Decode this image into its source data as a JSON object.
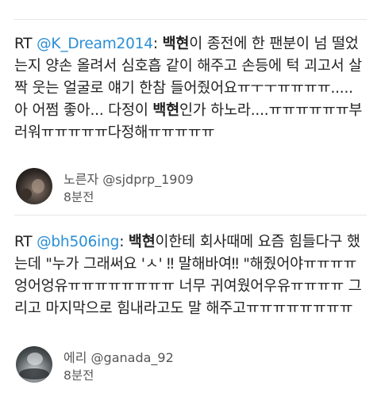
{
  "tweets": [
    {
      "prefix": "RT ",
      "mention": "@K_Dream2014",
      "colon": ": ",
      "bold1": "백현",
      "text1": "이 종전에 한 팬분이 넘 떨었는지 양손 올려서 심호흡 같이 해주고 손등에 턱 괴고서 살짝 웃는 얼굴로 얘기 한참 들어줬어요ㅠㅜㅜㅠㅠㅠㅠ..... 아 어쩜 좋아... 다정이 ",
      "bold2": "백현",
      "text2": "인가 하노라....ㅠㅠㅠㅠㅠㅠ부러워ㅠㅠㅠㅠㅠ다정해ㅠㅠㅠㅠㅠ",
      "display_name": "노른자",
      "handle": "@sjdprp_1909",
      "time": "8분전",
      "avatar_icon": "dark-photo-avatar"
    },
    {
      "prefix": "RT ",
      "mention": "@bh506ing",
      "colon": ": ",
      "bold1": "백현",
      "text1": "이한테 회사때메 요즘 힘들다구 했는데 \"누가 그래써요 'ㅅ' ‼ 말해바여‼ \"해줬어야ㅠㅠㅠㅠ엉어엉유ㅠㅠㅠㅠㅠㅠㅠㅠ 너무 귀여웠어우유ㅠㅠㅠㅠ 그리고 마지막으로 힘내라고도 말 해주고ㅠㅠㅠㅠㅠㅠㅠㅠ",
      "bold2": "",
      "text2": "",
      "display_name": "에리",
      "handle": "@ganada_92",
      "time": "8분전",
      "avatar_icon": "light-photo-avatar"
    }
  ],
  "colors": {
    "mention": "#2a8fd6",
    "text": "#222222",
    "meta": "#555555",
    "divider": "#e6e6e6"
  }
}
